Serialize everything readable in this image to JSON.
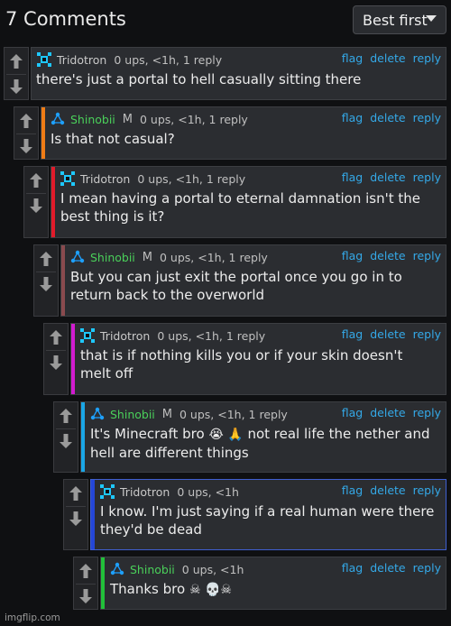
{
  "header": {
    "count_label": "7 Comments",
    "sort_label": "Best first"
  },
  "actions": {
    "flag": "flag",
    "delete": "delete",
    "reply": "reply"
  },
  "comments": [
    {
      "user": "Tridotron",
      "mod": "",
      "stats": "0 ups, <1h, 1 reply",
      "text": "there's just a portal to hell casually sitting there",
      "accent": ""
    },
    {
      "user": "Shinobii",
      "mod": "M",
      "stats": "0 ups, <1h, 1 reply",
      "text": "Is that not casual?",
      "accent": "#f07c16"
    },
    {
      "user": "Tridotron",
      "mod": "",
      "stats": "0 ups, <1h, 1 reply",
      "text": "I mean having a portal to eternal damnation isn't the best thing is it?",
      "accent": "#e11b2a"
    },
    {
      "user": "Shinobii",
      "mod": "M",
      "stats": "0 ups, <1h, 1 reply",
      "text": "But you can just exit the portal once you go in to return back to the overworld",
      "accent": "#8a4a4e"
    },
    {
      "user": "Tridotron",
      "mod": "",
      "stats": "0 ups, <1h, 1 reply",
      "text": "that is if nothing kills you or if your skin doesn't melt off",
      "accent": "#d21bd0"
    },
    {
      "user": "Shinobii",
      "mod": "M",
      "stats": "0 ups, <1h, 1 reply",
      "text_a": "It's Minecraft bro ",
      "emoji": "😭 🙏",
      "text_b": " not real life the nether and hell are different things",
      "accent": "#1aa6e6"
    },
    {
      "user": "Tridotron",
      "mod": "",
      "stats": "0 ups, <1h",
      "text": "I know. I'm just saying if a real human were there they'd be dead",
      "accent": "#2446d8"
    },
    {
      "user": "Shinobii",
      "mod": "",
      "stats": "0 ups, <1h",
      "text": "Thanks bro ",
      "emoji": "☠ 💀☠",
      "accent": "#22c03a"
    }
  ],
  "footer": {
    "watermark": "imgflip.com"
  }
}
